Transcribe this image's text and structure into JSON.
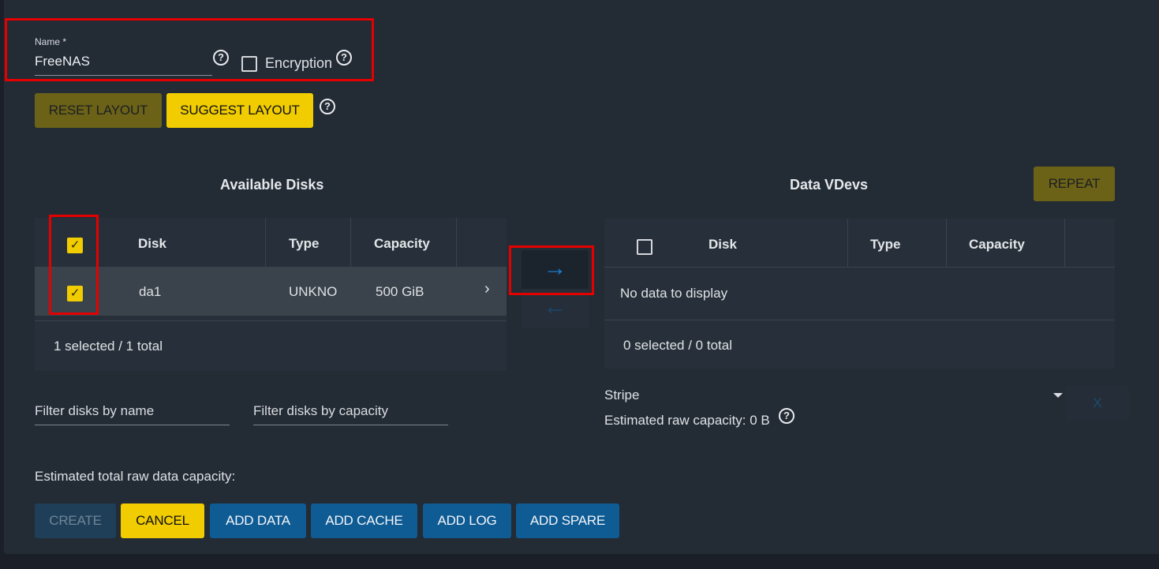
{
  "form": {
    "name_label": "Name *",
    "name_value": "FreeNAS",
    "encryption_label": "Encryption",
    "encryption_checked": false
  },
  "layout_buttons": {
    "reset": "RESET LAYOUT",
    "suggest": "SUGGEST LAYOUT"
  },
  "available_disks": {
    "title": "Available Disks",
    "columns": [
      "Disk",
      "Type",
      "Capacity"
    ],
    "rows": [
      {
        "disk": "da1",
        "type": "UNKNO",
        "capacity": "500 GiB",
        "selected": true
      }
    ],
    "footer": "1 selected / 1 total",
    "filter_name_placeholder": "Filter disks by name",
    "filter_capacity_placeholder": "Filter disks by capacity"
  },
  "data_vdevs": {
    "title": "Data VDevs",
    "repeat_label": "REPEAT",
    "columns": [
      "Disk",
      "Type",
      "Capacity"
    ],
    "empty_text": "No data to display",
    "footer": "0 selected / 0 total",
    "layout_value": "Stripe",
    "estimated_raw_capacity": "Estimated raw capacity: 0 B",
    "remove_label": "X"
  },
  "estimated_total": "Estimated total raw data capacity:",
  "actions": {
    "create": "CREATE",
    "cancel": "CANCEL",
    "add_data": "ADD DATA",
    "add_cache": "ADD CACHE",
    "add_log": "ADD LOG",
    "add_spare": "ADD SPARE"
  },
  "icons": {
    "help": "?",
    "check": "✓",
    "arrow_right": "→",
    "arrow_left": "←",
    "chevron_right": "›"
  },
  "colors": {
    "accent_yellow": "#f0cc00",
    "accent_blue": "#0f5b94",
    "annotation_red": "#e50000"
  }
}
